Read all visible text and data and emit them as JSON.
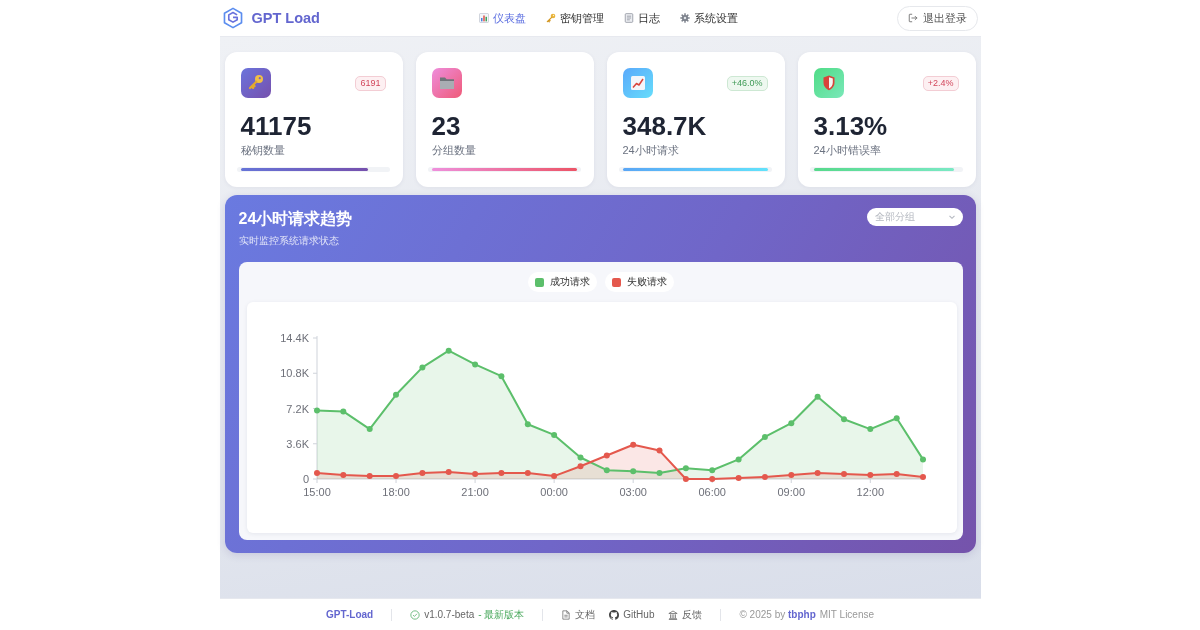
{
  "header": {
    "logo": "GPT Load",
    "nav": [
      {
        "label": "仪表盘",
        "selected": true
      },
      {
        "label": "密钥管理",
        "selected": false
      },
      {
        "label": "日志",
        "selected": false
      },
      {
        "label": "系统设置",
        "selected": false
      }
    ],
    "logout": "退出登录"
  },
  "stats": [
    {
      "value": "41175",
      "label": "秘钥数量",
      "badge": {
        "text": "6191",
        "warning": true
      },
      "level": 0.88
    },
    {
      "value": "23",
      "label": "分组数量",
      "level": 1
    },
    {
      "value": "348.7K",
      "label": "24小时请求",
      "badge": {
        "text": "+46.0%",
        "warning": false
      },
      "level": 1
    },
    {
      "value": "3.13%",
      "label": "24小时错误率",
      "badge": {
        "text": "+2.4%",
        "warning": true
      },
      "level": 0.97
    }
  ],
  "trend": {
    "title": "24小时请求趋势",
    "subtitle": "实时监控系统请求状态",
    "group_select": {
      "placeholder": "全部分组"
    },
    "chart_data": {
      "type": "area",
      "categories": [
        "15:00",
        null,
        null,
        "18:00",
        null,
        null,
        "21:00",
        null,
        null,
        "00:00",
        null,
        null,
        "03:00",
        null,
        null,
        "06:00",
        null,
        null,
        "09:00",
        null,
        null,
        "12:00",
        null,
        null
      ],
      "ylim": [
        0,
        14400
      ],
      "yticks": [
        {
          "value": 0,
          "label": "0"
        },
        {
          "value": 3600,
          "label": "3.6K"
        },
        {
          "value": 7200,
          "label": "7.2K"
        },
        {
          "value": 10800,
          "label": "10.8K"
        },
        {
          "value": 14400,
          "label": "14.4K"
        }
      ],
      "series": [
        {
          "name": "成功请求",
          "color": "#5cbf6b",
          "values": [
            7000,
            6900,
            5100,
            8600,
            11400,
            13100,
            11700,
            10500,
            5600,
            4500,
            2200,
            900,
            800,
            600,
            1100,
            900,
            2000,
            4300,
            5700,
            8400,
            6100,
            5100,
            6200,
            2000
          ]
        },
        {
          "name": "失败请求",
          "color": "#e4584d",
          "values": [
            600,
            400,
            300,
            300,
            600,
            700,
            500,
            600,
            600,
            300,
            1300,
            2400,
            3500,
            2900,
            0,
            0,
            100,
            200,
            400,
            600,
            500,
            400,
            500,
            200
          ]
        }
      ]
    }
  },
  "footer": {
    "brand": "GPT-Load",
    "version": "v1.0.7-beta",
    "version_status": "- 最新版本",
    "links": [
      "文档",
      "GitHub",
      "反馈"
    ],
    "copyright": {
      "text": "© 2025 by",
      "author": "tbphp"
    },
    "license": "MIT License"
  }
}
